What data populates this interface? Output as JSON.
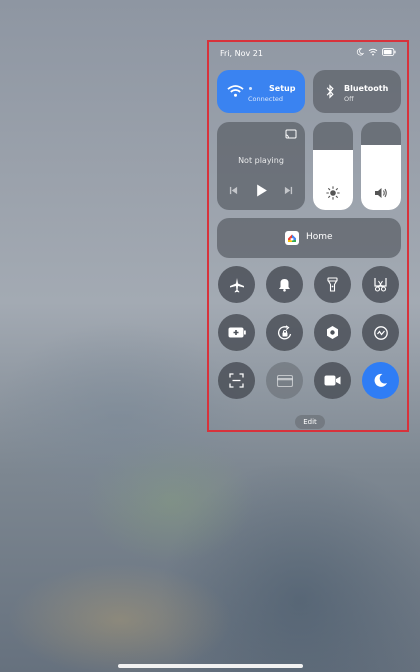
{
  "status_bar": {
    "date": "Fri, Nov 21",
    "icons": [
      "moon-icon",
      "wifi-icon",
      "battery-icon"
    ]
  },
  "wifi": {
    "label": "Setup",
    "status": "Connected",
    "color": "#3a83f1"
  },
  "bluetooth": {
    "label": "Bluetooth",
    "status": "Off"
  },
  "media": {
    "status": "Not playing",
    "controls": [
      "previous-icon",
      "play-icon",
      "next-icon"
    ]
  },
  "brightness": {
    "level": 0.68
  },
  "volume": {
    "level": 0.74
  },
  "home": {
    "label": "Home"
  },
  "toggles": [
    {
      "icon": "airplane-icon",
      "active": false
    },
    {
      "icon": "bell-icon",
      "active": false
    },
    {
      "icon": "flashlight-icon",
      "active": false
    },
    {
      "icon": "screenshot-icon",
      "active": false
    },
    {
      "icon": "battery-saver-icon",
      "active": false
    },
    {
      "icon": "rotation-lock-icon",
      "active": false
    },
    {
      "icon": "hexagon-settings-icon",
      "active": false
    },
    {
      "icon": "sync-icon",
      "active": false
    },
    {
      "icon": "scan-icon",
      "active": false
    },
    {
      "icon": "card-icon",
      "active": false
    },
    {
      "icon": "video-icon",
      "active": false
    },
    {
      "icon": "moon-icon",
      "active": true
    }
  ],
  "edit": {
    "label": "Edit"
  },
  "accent_color": "#2f7df5"
}
